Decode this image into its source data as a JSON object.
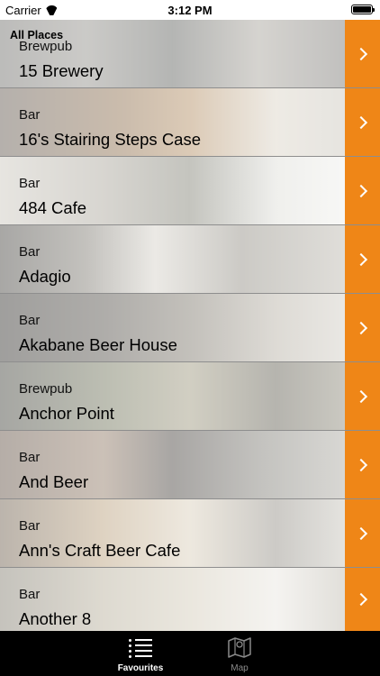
{
  "status_bar": {
    "carrier": "Carrier",
    "time": "3:12 PM"
  },
  "list": {
    "section_title": "All Places",
    "rows": [
      {
        "type": "Brewpub",
        "name": "15 Brewery"
      },
      {
        "type": "Bar",
        "name": "16's Stairing Steps Case"
      },
      {
        "type": "Bar",
        "name": "484 Cafe"
      },
      {
        "type": "Bar",
        "name": "Adagio"
      },
      {
        "type": "Bar",
        "name": "Akabane Beer House"
      },
      {
        "type": "Brewpub",
        "name": "Anchor Point"
      },
      {
        "type": "Bar",
        "name": "And Beer"
      },
      {
        "type": "Bar",
        "name": "Ann's Craft Beer Cafe"
      },
      {
        "type": "Bar",
        "name": "Another 8"
      }
    ]
  },
  "tab_bar": {
    "tabs": [
      {
        "label": "Favourites",
        "icon": "list-icon",
        "active": true
      },
      {
        "label": "Map",
        "icon": "map-icon",
        "active": false
      }
    ]
  },
  "colors": {
    "accent": "#ef8617",
    "tab_bar_bg": "#000000"
  }
}
